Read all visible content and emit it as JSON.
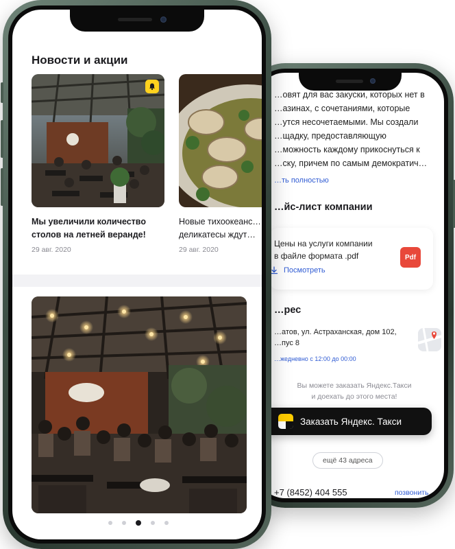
{
  "back_screen": {
    "description_lines": [
      "…овят для вас закуски, которых нет в",
      "…азинах, с сочетаниями, которые",
      "…утся несочетаемыми. Мы создали",
      "…щадку, предоставляющую",
      "…можность каждому прикоснуться к",
      "…ску, причем по самым демократич…"
    ],
    "read_more": "…ть полностью",
    "price_title": "…йс-лист компании",
    "price_card": {
      "lines": [
        "Цены на услуги компании",
        "в файле формата .pdf"
      ],
      "view_label": "Посмотреть",
      "badge": "Pdf",
      "download_icon": "download-icon"
    },
    "address_title": "…рес",
    "address_lines": [
      "…атов, ул. Астраханская, дом 102,",
      "…пус 8"
    ],
    "hours": "…жедневно с 12:00 до 00:00",
    "map_icon": "map-pin-icon",
    "taxi_hint_lines": [
      "Вы можете заказать Яндекс.Такси",
      "и доехать до этого места!"
    ],
    "taxi_button": "Заказать Яндекс. Такси",
    "more_addresses": "ещё 43 адреса",
    "phone": "+7 (8452) 404 555",
    "call": "позвонить"
  },
  "front_screen": {
    "news_title": "Новости и акции",
    "news": [
      {
        "headline_lines": [
          "Мы увеличили количество",
          "столов на летней веранде!"
        ],
        "date": "29 авг. 2020",
        "badge_icon": "bell-icon"
      },
      {
        "headline_lines": [
          "Новые тихоокеанс…",
          "деликатесы ждут…"
        ],
        "date": "29 авг. 2020"
      }
    ],
    "gallery": {
      "dot_count": 5,
      "active_index": 2
    }
  },
  "colors": {
    "accent_link": "#2f5bd3",
    "pdf_red": "#e8483a",
    "yandex_yellow": "#ffcc00",
    "button_dark": "#111111",
    "bell_badge_yellow": "#ffd21e"
  }
}
